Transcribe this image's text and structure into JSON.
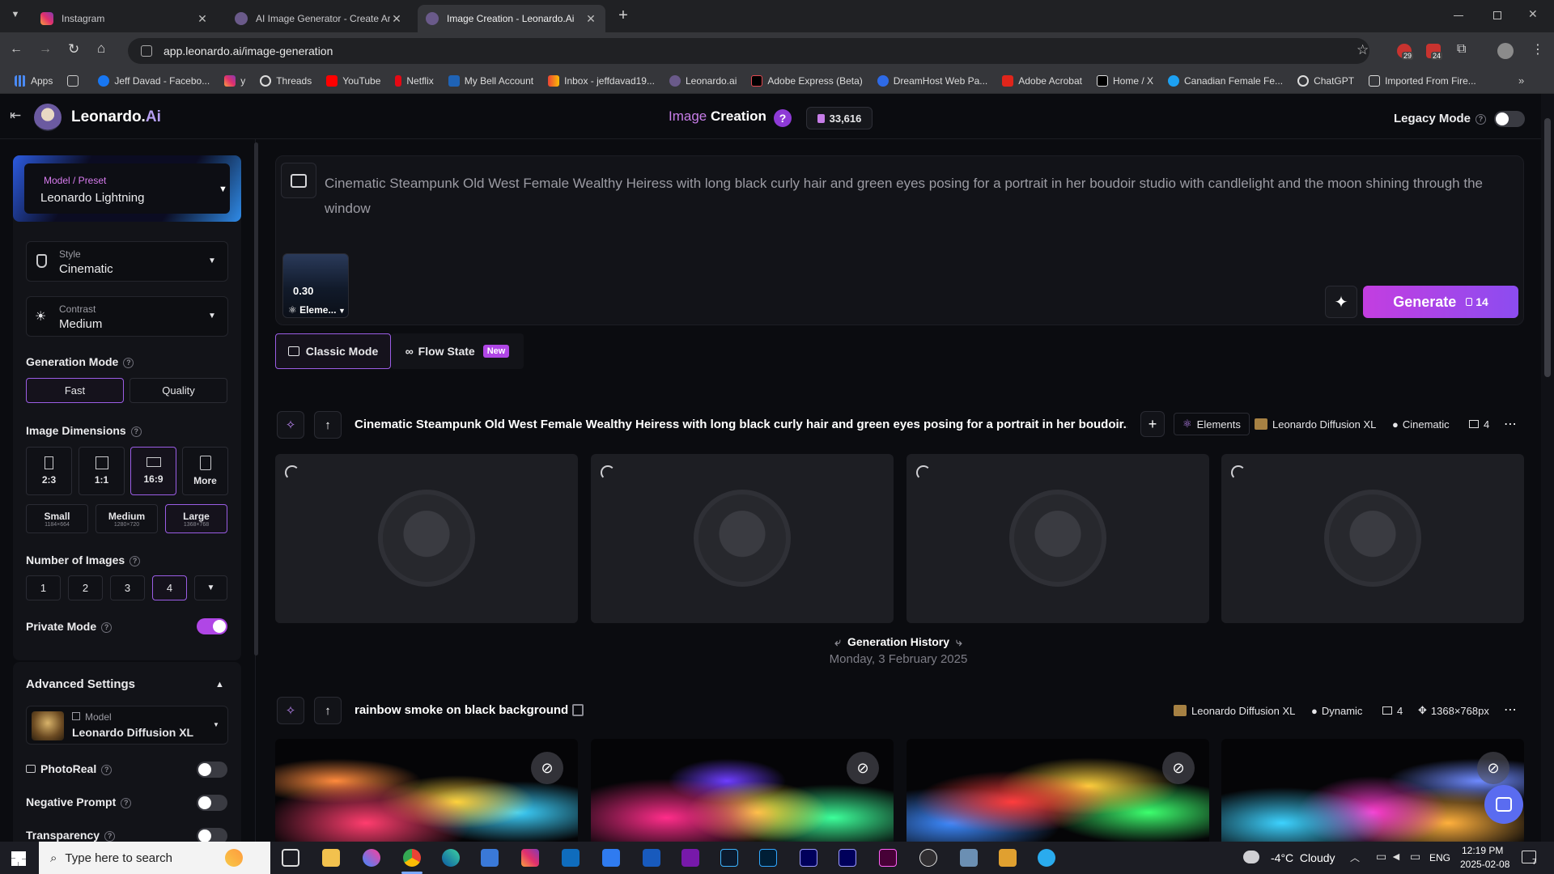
{
  "browser": {
    "tabs": [
      {
        "title": "Instagram",
        "active": false
      },
      {
        "title": "AI Image Generator - Create Ar",
        "active": false
      },
      {
        "title": "Image Creation - Leonardo.Ai",
        "active": true
      }
    ],
    "url": "app.leonardo.ai/image-generation",
    "ext_badges": [
      "29",
      "24"
    ],
    "bookmarks": [
      "Apps",
      "Jeff Davad - Facebo...",
      "y",
      "Threads",
      "YouTube",
      "Netflix",
      "My Bell Account",
      "Inbox - jeffdavad19...",
      "Leonardo.ai",
      "Adobe Express (Beta)",
      "DreamHost Web Pa...",
      "Adobe Acrobat",
      "Home / X",
      "Canadian Female Fe...",
      "ChatGPT",
      "Imported From Fire..."
    ]
  },
  "header": {
    "brand": "Leonardo.",
    "brand_ai": "Ai",
    "title_a": "Image",
    "title_b": "Creation",
    "help": "?",
    "credits": "33,616",
    "legacy_mode": "Legacy Mode"
  },
  "sidebar": {
    "preset_label": "Model / Preset",
    "preset_value": "Leonardo Lightning",
    "style_label": "Style",
    "style_value": "Cinematic",
    "contrast_label": "Contrast",
    "contrast_value": "Medium",
    "gen_mode_title": "Generation Mode",
    "gen_modes": [
      "Fast",
      "Quality"
    ],
    "dims_title": "Image Dimensions",
    "ratios": [
      "2:3",
      "1:1",
      "16:9",
      "More"
    ],
    "sizes": [
      {
        "label": "Small",
        "sub": "1184×664"
      },
      {
        "label": "Medium",
        "sub": "1280×720"
      },
      {
        "label": "Large",
        "sub": "1368×768"
      }
    ],
    "num_title": "Number of Images",
    "nums": [
      "1",
      "2",
      "3",
      "4"
    ],
    "private_mode": "Private Mode",
    "advanced_title": "Advanced Settings",
    "model_label": "Model",
    "model_value": "Leonardo Diffusion XL",
    "photoreal": "PhotoReal",
    "negative_prompt": "Negative Prompt",
    "transparency": "Transparency"
  },
  "prompt": {
    "text": "Cinematic Steampunk Old West Female Wealthy Heiress with long black curly hair and green eyes posing for a portrait in her boudoir studio with candlelight and the moon shining through the window",
    "element_weight": "0.30",
    "element_label": "Eleme...",
    "generate_label": "Generate",
    "generate_cost": "14"
  },
  "modes": {
    "classic": "Classic Mode",
    "flow": "Flow State",
    "new_badge": "New"
  },
  "current_generation": {
    "prompt": "Cinematic Steampunk Old West Female Wealthy Heiress with long black curly hair and green eyes posing for a portrait in her boudoir...",
    "elements": "Elements",
    "model": "Leonardo Diffusion XL",
    "style": "Cinematic",
    "count": "4"
  },
  "history": {
    "title": "Generation History",
    "date": "Monday, 3 February 2025"
  },
  "previous_generation": {
    "prompt": "rainbow smoke on black background",
    "model": "Leonardo Diffusion XL",
    "style": "Dynamic",
    "count": "4",
    "dims": "1368×768px"
  },
  "taskbar": {
    "search": "Type here to search",
    "weather": "-4°C  Cloudy",
    "lang": "ENG",
    "time": "12:19 PM",
    "date": "2025-02-08",
    "notif": "7"
  },
  "colors": {
    "accent": "#b046e6",
    "generate_from": "#c33ee0",
    "generate_to": "#8c4cf0"
  }
}
